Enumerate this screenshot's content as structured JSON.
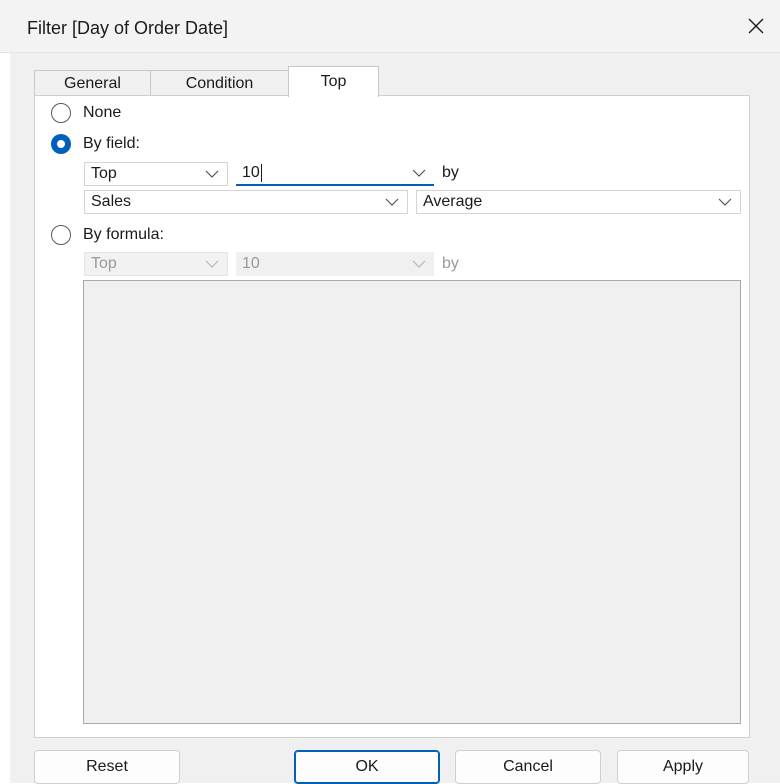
{
  "window": {
    "title": "Filter [Day of Order Date]"
  },
  "tabs": [
    {
      "label": "General"
    },
    {
      "label": "Condition"
    },
    {
      "label": "Top",
      "active": true
    }
  ],
  "options": {
    "none_label": "None",
    "by_field_label": "By field:",
    "by_formula_label": "By formula:",
    "selected": "By field:"
  },
  "by_field": {
    "direction": "Top",
    "count": "10",
    "by_label": "by",
    "field": "Sales",
    "aggregation": "Average"
  },
  "by_formula": {
    "direction": "Top",
    "count": "10",
    "by_label": "by",
    "formula": ""
  },
  "buttons": {
    "reset": "Reset",
    "ok": "OK",
    "cancel": "Cancel",
    "apply": "Apply"
  },
  "colors": {
    "accent": "#005fb8",
    "disabled_text": "#9a9a9a"
  },
  "icons": {
    "close": "close-icon",
    "dropdown": "chevron-down-icon"
  }
}
